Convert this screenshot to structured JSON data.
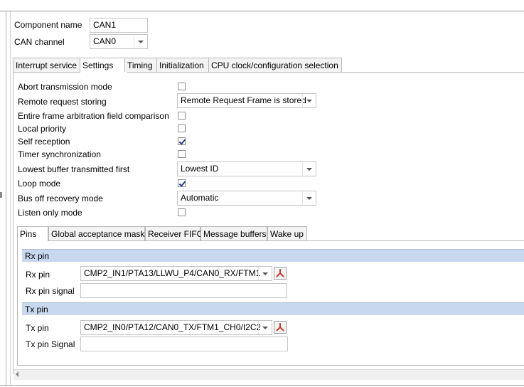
{
  "component": {
    "name_label": "Component name",
    "name_value": "CAN1",
    "channel_label": "CAN channel",
    "channel_value": "CAN0"
  },
  "main_tabs": [
    "Interrupt service",
    "Settings",
    "Timing",
    "Initialization",
    "CPU clock/configuration selection"
  ],
  "settings": {
    "abort_label": "Abort transmission mode",
    "remote_label": "Remote request storing",
    "remote_value": "Remote Request Frame is stored",
    "arbitration_label": "Entire frame arbitration field comparison",
    "local_priority_label": "Local priority",
    "self_reception_label": "Self reception",
    "timer_sync_label": "Timer synchronization",
    "lowest_buffer_label": "Lowest buffer transmitted first",
    "lowest_buffer_value": "Lowest ID",
    "loop_mode_label": "Loop mode",
    "bus_off_label": "Bus off recovery mode",
    "bus_off_value": "Automatic",
    "listen_only_label": "Listen only mode"
  },
  "checks": {
    "abort": false,
    "arbitration": false,
    "local_priority": false,
    "self_reception": true,
    "timer_sync": false,
    "loop_mode": true,
    "listen_only": false
  },
  "sub_tabs": [
    "Pins",
    "Global acceptance mask",
    "Receiver FIFO",
    "Message buffers",
    "Wake up"
  ],
  "pins": {
    "rx_header": "Rx pin",
    "rx_label": "Rx pin",
    "rx_value": "CMP2_IN1/PTA13/LLWU_P4/CAN0_RX/FTM1_(",
    "rx_signal_label": "Rx pin signal",
    "rx_signal_value": "",
    "tx_header": "Tx pin",
    "tx_label": "Tx pin",
    "tx_value": "CMP2_IN0/PTA12/CAN0_TX/FTM1_CH0/I2C2_!",
    "tx_signal_label": "Tx pin Signal",
    "tx_signal_value": ""
  },
  "colors": {
    "section_header": "#c8d9ef",
    "pin_button_icon": "#c0392b"
  },
  "icons": {
    "pin_button": "pin-assign-icon"
  }
}
